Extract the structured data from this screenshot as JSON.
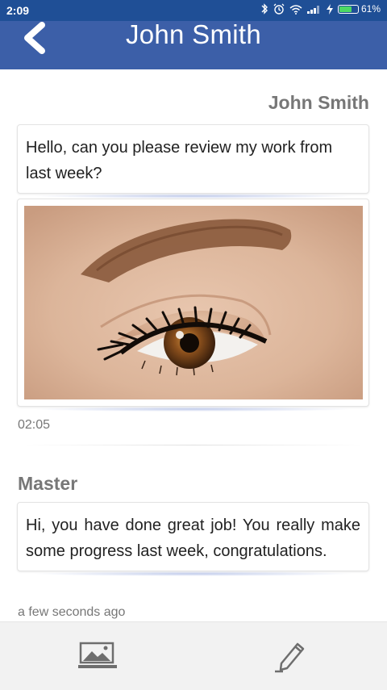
{
  "status_bar": {
    "time": "2:09",
    "battery_percent": "61%",
    "battery_level": 0.61,
    "icons": [
      "bluetooth-icon",
      "alarm-icon",
      "wifi-icon",
      "signal-icon",
      "charging-icon",
      "battery-icon"
    ]
  },
  "header": {
    "title": "John Smith",
    "back_icon": "chevron-left-icon"
  },
  "conversation": {
    "first_sender": "John Smith",
    "first_message": "Hello, can you please review my work from last week?",
    "photo_subject": "eye-with-eyelash-extensions",
    "first_time": "02:05",
    "second_sender": "Master",
    "second_message": "Hi, you have done great job! You really make some progress last week, congratulations.",
    "second_time": "a few seconds ago"
  },
  "toolbar": {
    "left_icon": "image-gallery-icon",
    "right_icon": "pencil-icon"
  },
  "colors": {
    "status_bar": "#1f4f96",
    "header": "#3c5fa8",
    "sender_text": "#777777",
    "toolbar_bg": "#f2f2f2"
  }
}
